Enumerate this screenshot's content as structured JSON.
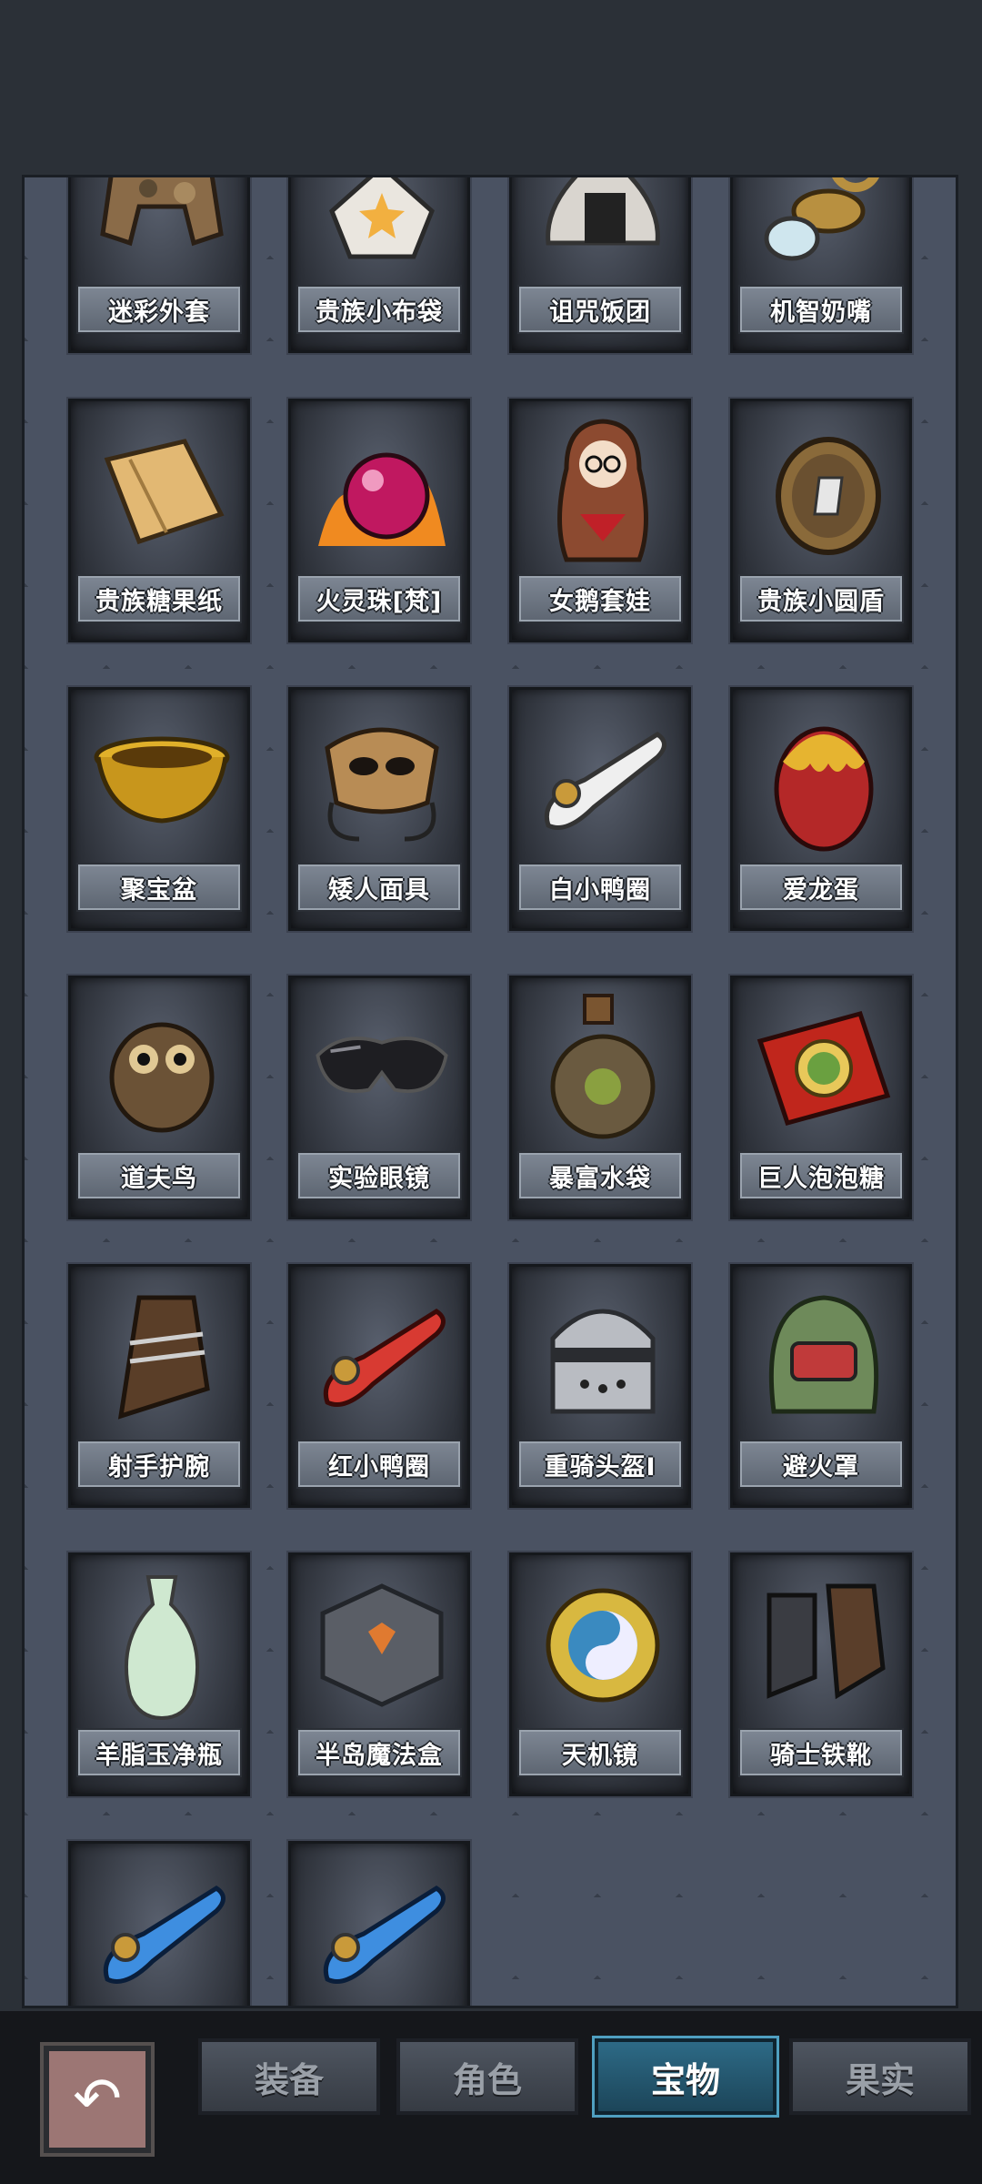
{
  "items": [
    {
      "name": "迷彩外套",
      "icon": "camo-coat-icon"
    },
    {
      "name": "贵族小布袋",
      "icon": "cloth-bag-icon"
    },
    {
      "name": "诅咒饭团",
      "icon": "rice-ball-icon"
    },
    {
      "name": "机智奶嘴",
      "icon": "pacifier-icon"
    },
    {
      "name": "贵族糖果纸",
      "icon": "candy-wrapper-icon"
    },
    {
      "name": "火灵珠[梵]",
      "icon": "fire-orb-icon"
    },
    {
      "name": "女鹅套娃",
      "icon": "nesting-doll-icon"
    },
    {
      "name": "贵族小圆盾",
      "icon": "round-shield-icon"
    },
    {
      "name": "聚宝盆",
      "icon": "treasure-bowl-icon"
    },
    {
      "name": "矮人面具",
      "icon": "dwarf-mask-icon"
    },
    {
      "name": "白小鸭圈",
      "icon": "white-duck-ring-icon"
    },
    {
      "name": "爱龙蛋",
      "icon": "dragon-egg-icon"
    },
    {
      "name": "道夫鸟",
      "icon": "owl-bird-icon"
    },
    {
      "name": "实验眼镜",
      "icon": "goggles-icon"
    },
    {
      "name": "暴富水袋",
      "icon": "water-flask-icon"
    },
    {
      "name": "巨人泡泡糖",
      "icon": "bubblegum-icon"
    },
    {
      "name": "射手护腕",
      "icon": "bracer-icon"
    },
    {
      "name": "红小鸭圈",
      "icon": "red-duck-ring-icon"
    },
    {
      "name": "重骑头盔I",
      "icon": "knight-helmet-icon"
    },
    {
      "name": "避火罩",
      "icon": "fire-hood-icon"
    },
    {
      "name": "羊脂玉净瓶",
      "icon": "jade-vase-icon"
    },
    {
      "name": "半岛魔法盒",
      "icon": "magic-cube-icon"
    },
    {
      "name": "天机镜",
      "icon": "bagua-mirror-icon"
    },
    {
      "name": "骑士铁靴",
      "icon": "iron-boots-icon"
    },
    {
      "name": "",
      "icon": "blue-duck-ring-icon"
    },
    {
      "name": "",
      "icon": "blue-duck-ring-icon"
    }
  ],
  "tabs": [
    {
      "label": "装备",
      "active": false
    },
    {
      "label": "角色",
      "active": false
    },
    {
      "label": "宝物",
      "active": true
    },
    {
      "label": "果实",
      "active": false
    }
  ],
  "back_icon": "back-arrow-icon"
}
